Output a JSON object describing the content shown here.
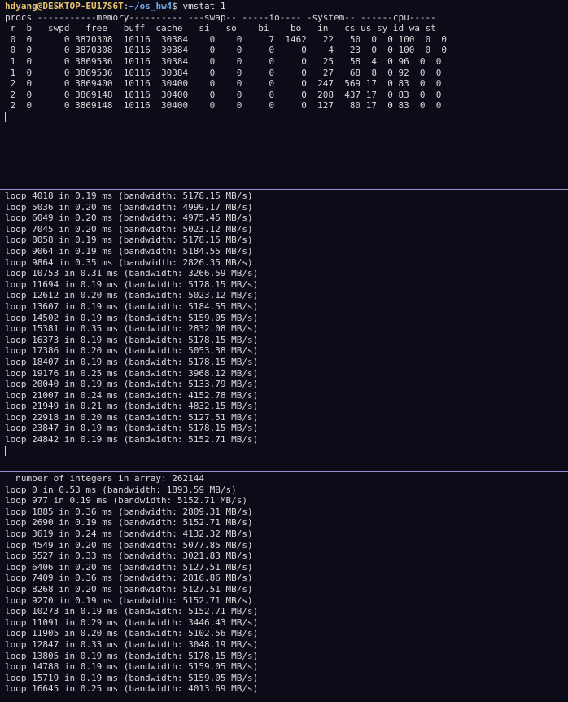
{
  "vmstat_pane": {
    "prompt_user_host": "hdyang@DESKTOP-EU17S6T",
    "prompt_sep": ":",
    "prompt_path": "~/os_hw4",
    "prompt_symbol": "$",
    "command": " vmstat 1",
    "lines": [
      "procs -----------memory---------- ---swap-- -----io---- -system-- ------cpu-----",
      " r  b   swpd   free   buff  cache   si   so    bi    bo   in   cs us sy id wa st",
      " 0  0      0 3870308  10116  30384    0    0     7  1462   22   50  0  0 100  0  0",
      " 0  0      0 3870308  10116  30384    0    0     0     0    4   23  0  0 100  0  0",
      " 1  0      0 3869536  10116  30384    0    0     0     0   25   58  4  0 96  0  0",
      " 1  0      0 3869536  10116  30384    0    0     0     0   27   68  8  0 92  0  0",
      " 2  0      0 3869400  10116  30400    0    0     0     0  247  569 17  0 83  0  0",
      " 2  0      0 3869148  10116  30400    0    0     0     0  208  437 17  0 83  0  0",
      " 2  0      0 3869148  10116  30400    0    0     0     0  127   80 17  0 83  0  0"
    ]
  },
  "loop_pane_1": {
    "lines": [
      "loop 4018 in 0.19 ms (bandwidth: 5178.15 MB/s)",
      "loop 5036 in 0.20 ms (bandwidth: 4999.17 MB/s)",
      "loop 6049 in 0.20 ms (bandwidth: 4975.45 MB/s)",
      "loop 7045 in 0.20 ms (bandwidth: 5023.12 MB/s)",
      "loop 8058 in 0.19 ms (bandwidth: 5178.15 MB/s)",
      "loop 9064 in 0.19 ms (bandwidth: 5184.55 MB/s)",
      "loop 9864 in 0.35 ms (bandwidth: 2826.35 MB/s)",
      "loop 10753 in 0.31 ms (bandwidth: 3266.59 MB/s)",
      "loop 11694 in 0.19 ms (bandwidth: 5178.15 MB/s)",
      "loop 12612 in 0.20 ms (bandwidth: 5023.12 MB/s)",
      "loop 13607 in 0.19 ms (bandwidth: 5184.55 MB/s)",
      "loop 14502 in 0.19 ms (bandwidth: 5159.05 MB/s)",
      "loop 15381 in 0.35 ms (bandwidth: 2832.08 MB/s)",
      "loop 16373 in 0.19 ms (bandwidth: 5178.15 MB/s)",
      "loop 17386 in 0.20 ms (bandwidth: 5053.38 MB/s)",
      "loop 18407 in 0.19 ms (bandwidth: 5178.15 MB/s)",
      "loop 19176 in 0.25 ms (bandwidth: 3968.12 MB/s)",
      "loop 20040 in 0.19 ms (bandwidth: 5133.79 MB/s)",
      "loop 21007 in 0.24 ms (bandwidth: 4152.78 MB/s)",
      "loop 21949 in 0.21 ms (bandwidth: 4832.15 MB/s)",
      "loop 22918 in 0.20 ms (bandwidth: 5127.51 MB/s)",
      "loop 23847 in 0.19 ms (bandwidth: 5178.15 MB/s)",
      "loop 24842 in 0.19 ms (bandwidth: 5152.71 MB/s)"
    ]
  },
  "loop_pane_2": {
    "lines": [
      "  number of integers in array: 262144",
      "loop 0 in 0.53 ms (bandwidth: 1893.59 MB/s)",
      "loop 977 in 0.19 ms (bandwidth: 5152.71 MB/s)",
      "loop 1885 in 0.36 ms (bandwidth: 2809.31 MB/s)",
      "loop 2690 in 0.19 ms (bandwidth: 5152.71 MB/s)",
      "loop 3619 in 0.24 ms (bandwidth: 4132.32 MB/s)",
      "loop 4549 in 0.20 ms (bandwidth: 5077.85 MB/s)",
      "loop 5527 in 0.33 ms (bandwidth: 3021.83 MB/s)",
      "loop 6406 in 0.20 ms (bandwidth: 5127.51 MB/s)",
      "loop 7409 in 0.36 ms (bandwidth: 2816.86 MB/s)",
      "loop 8268 in 0.20 ms (bandwidth: 5127.51 MB/s)",
      "loop 9270 in 0.19 ms (bandwidth: 5152.71 MB/s)",
      "loop 10273 in 0.19 ms (bandwidth: 5152.71 MB/s)",
      "loop 11091 in 0.29 ms (bandwidth: 3446.43 MB/s)",
      "loop 11905 in 0.20 ms (bandwidth: 5102.56 MB/s)",
      "loop 12847 in 0.33 ms (bandwidth: 3048.19 MB/s)",
      "loop 13805 in 0.19 ms (bandwidth: 5178.15 MB/s)",
      "loop 14788 in 0.19 ms (bandwidth: 5159.05 MB/s)",
      "loop 15719 in 0.19 ms (bandwidth: 5159.05 MB/s)",
      "loop 16645 in 0.25 ms (bandwidth: 4013.69 MB/s)"
    ]
  },
  "colors": {
    "background": "#0c0c18",
    "foreground": "#d9d9d9",
    "prompt_user": "#e5c26b",
    "prompt_path": "#6fa8ef",
    "divider": "#9a8fcf"
  }
}
